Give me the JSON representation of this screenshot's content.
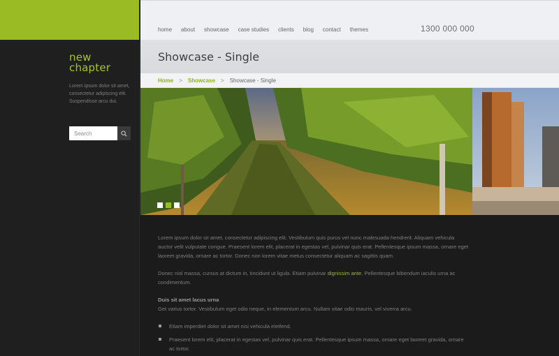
{
  "sidebar": {
    "logo_line1": "new",
    "logo_line2": "chapter",
    "tagline": "Lorem ipsum dolor sit amet, consectetur adipiscing elit. Suspendisse arcu dui.",
    "search_placeholder": "Search",
    "search_icon": "search-icon"
  },
  "header": {
    "nav": [
      "home",
      "about",
      "showcase",
      "case studies",
      "clients",
      "blog",
      "contact",
      "themes"
    ],
    "phone": "1300 000 000"
  },
  "title": "Showcase - Single",
  "breadcrumb": {
    "home": "Home",
    "sep": ">",
    "section": "Showcase",
    "current": "Showcase - Single"
  },
  "slider": {
    "dot_colors": [
      "#ffffff",
      "#9bbb24",
      "#ffffff"
    ]
  },
  "content": {
    "p1": "Lorem ipsum dolor sit amet, consectetur adipiscing elit. Vestibulum quis purus vel nunc malesuada hendrerit. Aliquam vehicula auctor velit vulputate congue. Praesent lorem elit, placerat in egestas vel, pulvinar quis erat. Pellentesque ipsum massa, ornare eget laoreet gravida, ornare ac tortor. Donec non lorem vitae metus consectetur aliquam ac sagittis quam.",
    "p2_before": "Donec nisl massa, cursus at dictum in, tincidunt ut ligula. Etiam pulvinar ",
    "p2_link": "dignissim ante",
    "p2_after": ". Pellentesque bibendum iaculis urna ac condimentum.",
    "p3_heading": "Duis sit amet lacus urna",
    "p3_text": "Get varius tortor. Vestibulum eget odio neque, in elementum arcu. Nullam vitae odio mauris, vel viverra arcu.",
    "bullets": [
      "Etiam imperdiet dolor sit amet nisi vehicula eleifend.",
      "Praesent lorem elit, placerat in egestas vel, pulvinar quis erat. Pellentesque ipsum massa, ornare eget laoreet gravida, ornare ac tortor."
    ]
  },
  "colors": {
    "accent": "#9bbb24",
    "sidebar_bg": "#1f1f1f",
    "content_bg": "#1b1b1b"
  }
}
